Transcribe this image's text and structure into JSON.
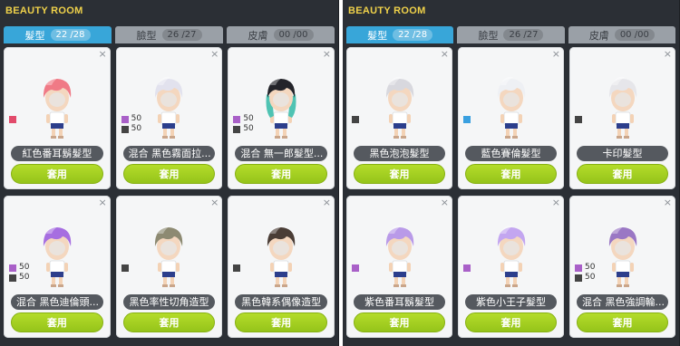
{
  "colors": {
    "accent_tab": "#38a6d9",
    "apply_button": "#9ccb1f",
    "title": "#f0d24a",
    "panel_bg": "#2b2f35"
  },
  "close_icon": "×",
  "apply_label": "套用",
  "panels": [
    {
      "title": "BEAUTY ROOM",
      "tabs": [
        {
          "label": "髮型",
          "count": "22 /28",
          "active": true
        },
        {
          "label": "臉型",
          "count": "26 /27",
          "active": false
        },
        {
          "label": "皮膚",
          "count": "00 /00",
          "active": false
        }
      ],
      "cards": [
        {
          "name": "紅色番耳鬍髮型",
          "hair": "#f07a86",
          "swatches": [
            {
              "color": "#e24b6b",
              "value": ""
            }
          ]
        },
        {
          "name": "混合 黑色霧面拉...",
          "hair": "#e2e2ee",
          "swatches": [
            {
              "color": "#a960c8",
              "value": "50"
            },
            {
              "color": "#444444",
              "value": "50"
            }
          ]
        },
        {
          "name": "混合 無一郎髮型...",
          "hair": "#23242a",
          "hair_tips": "#4fc3b3",
          "swatches": [
            {
              "color": "#a960c8",
              "value": "50"
            },
            {
              "color": "#444444",
              "value": "50"
            }
          ]
        },
        {
          "name": "混合 黑色迪倫頭...",
          "hair": "#a66ee0",
          "swatches": [
            {
              "color": "#a960c8",
              "value": "50"
            },
            {
              "color": "#444444",
              "value": "50"
            }
          ]
        },
        {
          "name": "黑色率性切角造型",
          "hair": "#8d8a72",
          "swatches": [
            {
              "color": "#444444",
              "value": ""
            }
          ]
        },
        {
          "name": "黑色韓系偶像造型",
          "hair": "#4a3d36",
          "swatches": [
            {
              "color": "#444444",
              "value": ""
            }
          ]
        }
      ]
    },
    {
      "title": "BEAUTY ROOM",
      "tabs": [
        {
          "label": "髮型",
          "count": "22 /28",
          "active": true
        },
        {
          "label": "臉型",
          "count": "26 /27",
          "active": false
        },
        {
          "label": "皮膚",
          "count": "00 /00",
          "active": false
        }
      ],
      "cards": [
        {
          "name": "黑色泡泡髮型",
          "hair": "#d8d8de",
          "swatches": [
            {
              "color": "#444444",
              "value": ""
            }
          ]
        },
        {
          "name": "藍色賽倫髮型",
          "hair": "#eef0f4",
          "swatches": [
            {
              "color": "#3aa0e0",
              "value": ""
            }
          ]
        },
        {
          "name": "卡印髮型",
          "hair": "#e6e6ea",
          "swatches": [
            {
              "color": "#444444",
              "value": ""
            }
          ]
        },
        {
          "name": "紫色番耳鬍髮型",
          "hair": "#b99ae8",
          "swatches": [
            {
              "color": "#a960c8",
              "value": ""
            }
          ]
        },
        {
          "name": "紫色小王子髮型",
          "hair": "#c3a6f0",
          "swatches": [
            {
              "color": "#a960c8",
              "value": ""
            }
          ]
        },
        {
          "name": "混合 黑色強調輪...",
          "hair": "#9a77c4",
          "swatches": [
            {
              "color": "#a960c8",
              "value": "50"
            },
            {
              "color": "#444444",
              "value": "50"
            }
          ]
        }
      ]
    }
  ]
}
